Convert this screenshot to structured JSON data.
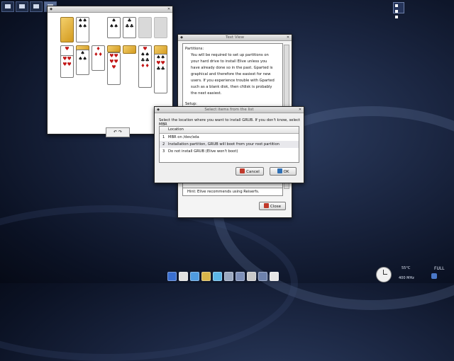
{
  "desktop": {
    "workspaces": 3,
    "tray_label": "FULL",
    "temp": "55°C",
    "cpu": "400 MHz"
  },
  "solitaire": {
    "title": "",
    "undo_label": "↶ ↷"
  },
  "text_view": {
    "title": "Text View",
    "heading1": "Partitions:",
    "para1": [
      "You will be required to set up partitions on",
      "your hard drive to install Elive unless you",
      "have already done so in the past. Gparted is",
      "graphical and therefore the easiest for new",
      "users. If you experience trouble with Gparted",
      "such as a blank disk, then cfdisk is probably",
      "the next easiest."
    ],
    "heading2": "Setup:",
    "hint": "Hint: Elive recommends using Reiserfs.",
    "close_label": "Close"
  },
  "select_dialog": {
    "title": "Select items from the list",
    "prompt": "Select the location where you want to install GRUB. If you don't know, select MBR",
    "column_header": "Location",
    "rows": [
      {
        "n": "1",
        "text": "MBR on /dev/sda"
      },
      {
        "n": "2",
        "text": "Installation partition, GRUB will boot from your root partition"
      },
      {
        "n": "3",
        "text": "Do not install GRUB (Elive won't boot)"
      }
    ],
    "cancel_label": "Cancel",
    "ok_label": "OK",
    "colors": {
      "cancel_icon": "#c0392b",
      "ok_icon": "#2d6fb5",
      "selected_row": "#e8e8ec"
    }
  },
  "dock_apps": [
    "terminal",
    "files",
    "browser",
    "mail",
    "chat",
    "media",
    "settings",
    "disc",
    "trash",
    "package"
  ]
}
